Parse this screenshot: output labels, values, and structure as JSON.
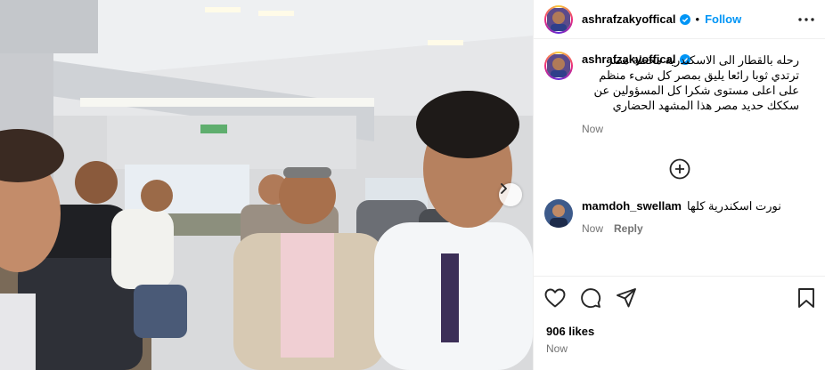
{
  "post": {
    "username": "ashrafzakyoffical",
    "follow_label": "Follow",
    "separator": "•",
    "caption": "رحله بالقطار الى الاسكندرية محطة مصر ترتدي ثوبا رائعا يليق بمصر كل شىء منظم على اعلى مستوى شكرا كل المسؤولين عن سككك حديد مصر هذا المشهد الحضاري",
    "caption_time": "Now",
    "likes": "906 likes",
    "post_time": "Now"
  },
  "comments": [
    {
      "username": "mamdoh_swellam",
      "text": "نورت اسكندرية كلها",
      "time": "Now",
      "reply_label": "Reply"
    }
  ],
  "icons": {
    "more": "more-options-icon",
    "verified": "verified-badge-icon",
    "add_comment": "add-comment-plus-icon",
    "like": "heart-icon",
    "comment": "comment-bubble-icon",
    "share": "share-paper-plane-icon",
    "save": "bookmark-icon",
    "carousel_next": "chevron-right-icon"
  },
  "colors": {
    "follow_blue": "#0095f6",
    "verified_blue": "#0095f6",
    "muted_text": "#737373",
    "divider": "#efefef"
  }
}
